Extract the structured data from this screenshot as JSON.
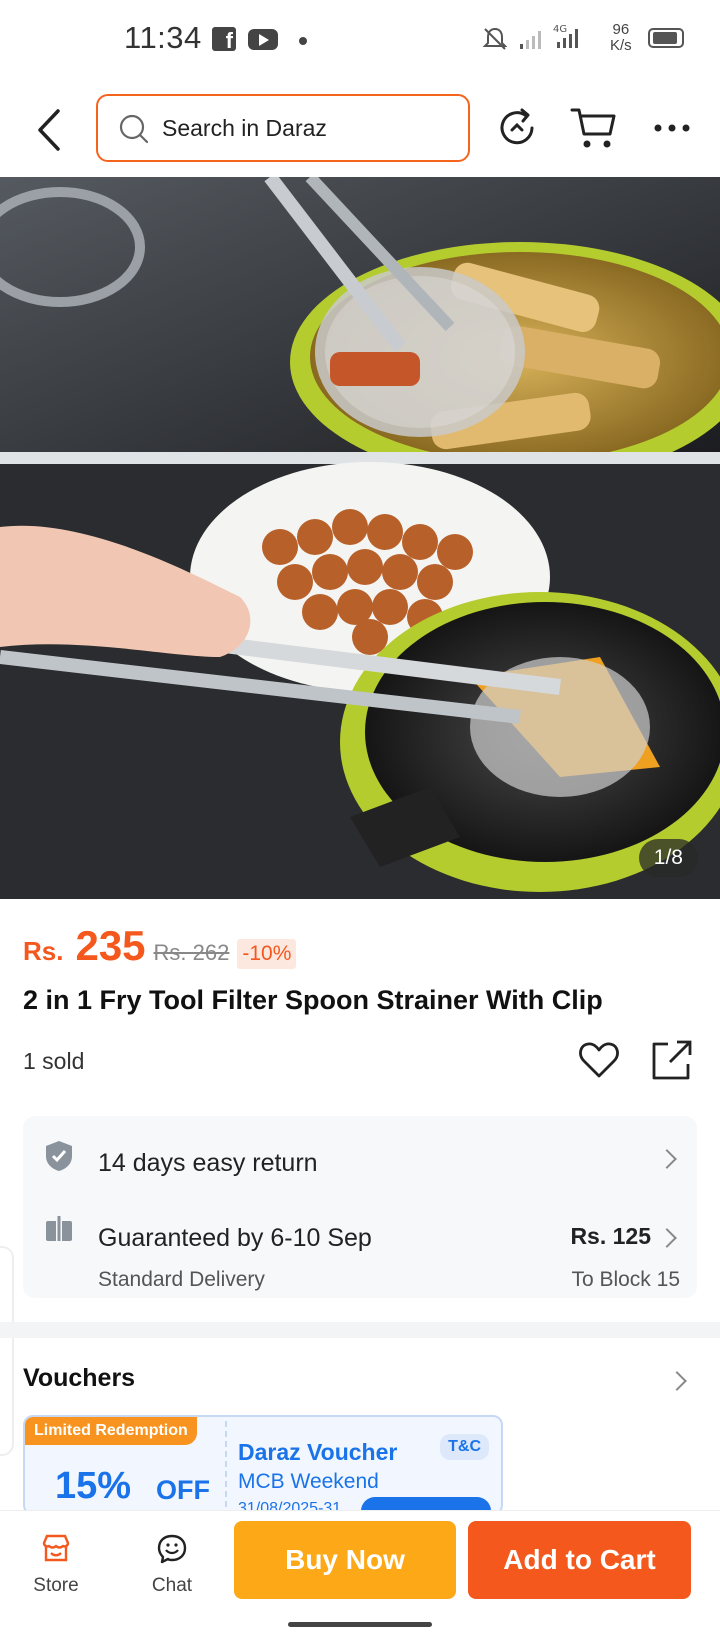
{
  "status_bar": {
    "time": "11:34",
    "network": "4G",
    "speed": "96",
    "speed_unit": "K/s"
  },
  "header": {
    "search_placeholder": "Search in Daraz",
    "icons": [
      "back-icon",
      "search-icon",
      "share-refresh-icon",
      "cart-icon",
      "more-icon"
    ]
  },
  "gallery": {
    "counter": "1/8"
  },
  "product": {
    "currency": "Rs.",
    "price": "235",
    "original_price": "Rs. 262",
    "discount": "-10%",
    "title": "2 in 1 Fry Tool Filter Spoon Strainer With Clip",
    "sold": "1 sold"
  },
  "service": {
    "return": "14 days easy return",
    "delivery": "Guaranteed by 6-10 Sep",
    "delivery_type": "Standard Delivery",
    "delivery_fee": "Rs. 125",
    "destination": "To Block 15"
  },
  "vouchers": {
    "title": "Vouchers",
    "items": [
      {
        "badge": "Limited Redemption",
        "percent": "15%",
        "off": "OFF",
        "name": "Daraz Voucher",
        "subtitle": "MCB Weekend",
        "date": "31/08/2025-31",
        "tc": "T&C"
      }
    ]
  },
  "bottom_bar": {
    "store": "Store",
    "chat": "Chat",
    "buy_now": "Buy Now",
    "add_to_cart": "Add to Cart"
  },
  "colors": {
    "accent": "#f4581d",
    "buy_now": "#fca817",
    "voucher_blue": "#1a73e8"
  }
}
